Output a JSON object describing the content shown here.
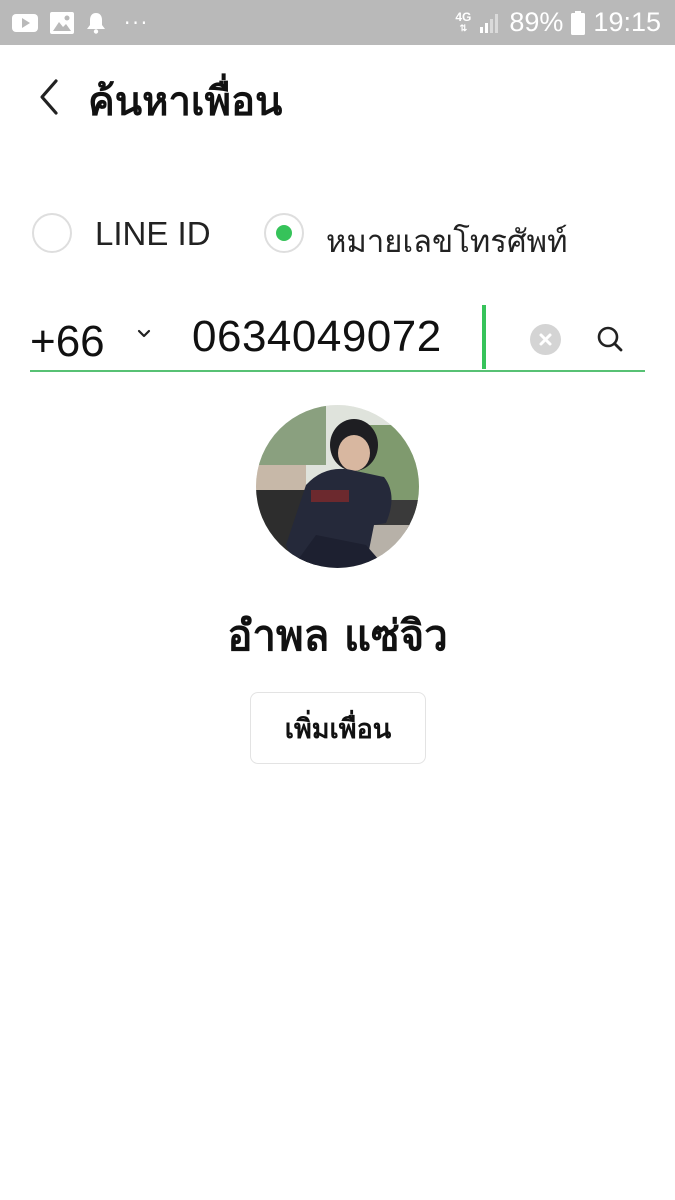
{
  "status_bar": {
    "icons": [
      "youtube-icon",
      "gallery-icon",
      "notification-bell-icon",
      "more-dots-icon"
    ],
    "more": "···",
    "network": "4G",
    "battery": "89%",
    "time": "19:15"
  },
  "header": {
    "back_icon": "chevron-left-icon",
    "title": "ค้นหาเพื่อน"
  },
  "search_type": {
    "options": [
      {
        "label": "LINE ID",
        "selected": false
      },
      {
        "label": "หมายเลขโทรศัพท์",
        "selected": true
      }
    ]
  },
  "search": {
    "country_code": "+66",
    "phone_value": "0634049072",
    "clear_icon": "clear-icon",
    "search_icon": "search-icon"
  },
  "result": {
    "name": "อำพล แซ่จิว",
    "add_friend_label": "เพิ่มเพื่อน"
  },
  "colors": {
    "status_bar": "#b9b9b9",
    "accent_green": "#36c35a",
    "underline_green": "#57c174",
    "text": "#111111"
  }
}
